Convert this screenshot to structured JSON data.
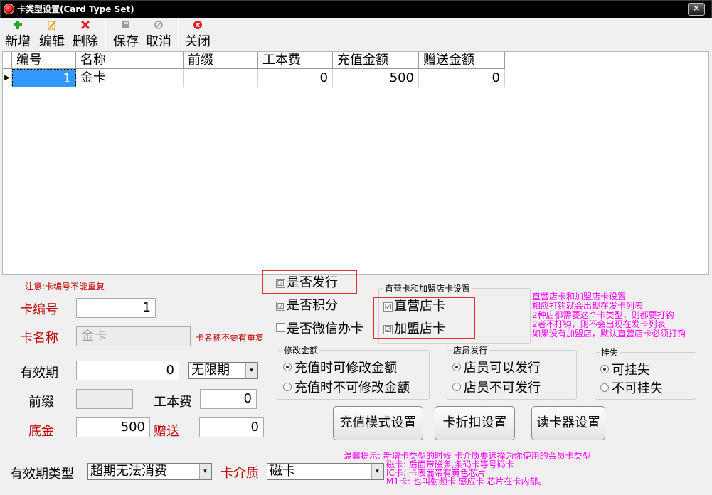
{
  "window": {
    "title": "卡类型设置(Card Type Set)",
    "close": "✕"
  },
  "toolbar": [
    {
      "key": "add",
      "label": "新增",
      "icon": "plus-icon"
    },
    {
      "key": "edit",
      "label": "编辑",
      "icon": "edit-icon"
    },
    {
      "key": "delete",
      "label": "删除",
      "icon": "delete-icon"
    },
    {
      "key": "save",
      "label": "保存",
      "icon": "save-icon"
    },
    {
      "key": "cancel",
      "label": "取消",
      "icon": "cancel-icon"
    },
    {
      "key": "close",
      "label": "关闭",
      "icon": "close-circle-icon"
    }
  ],
  "grid": {
    "columns": [
      "编号",
      "名称",
      "前缀",
      "工本费",
      "充值金额",
      "赠送金额"
    ],
    "rows": [
      [
        "1",
        "金卡",
        "",
        "0",
        "500",
        "0"
      ]
    ]
  },
  "form": {
    "notice": "注意:卡编号不能重复",
    "card_no_label": "卡编号",
    "card_no": "1",
    "card_name_label": "卡名称",
    "card_name": "金卡",
    "card_name_hint": "卡名称不要有重复",
    "validity_label": "有效期",
    "validity_value": "0",
    "validity_unit": "无限期",
    "prefix_label": "前缀",
    "prefix_value": "",
    "cost_label": "工本费",
    "cost_value": "0",
    "base_label": "底金",
    "base_value": "500",
    "gift_label": "赠送",
    "gift_value": "0",
    "validity_type_label": "有效期类型",
    "validity_type": "超期无法消费",
    "medium_label": "卡介质",
    "medium": "磁卡"
  },
  "checks": {
    "issue": {
      "label": "是否发行",
      "checked": true
    },
    "points": {
      "label": "是否积分",
      "checked": true
    },
    "wechat": {
      "label": "是否微信办卡",
      "checked": false
    }
  },
  "store_group": {
    "title": "直营卡和加盟店卡设置",
    "direct": {
      "label": "直营店卡",
      "checked": true
    },
    "franchise": {
      "label": "加盟店卡",
      "checked": true
    }
  },
  "store_note": [
    "直营店卡和加盟店卡设置",
    "相应打钩就会出现在发卡列表",
    "2种店都需要这个卡类型，则都要打钩",
    "2者不打钩，则不会出现在发卡列表",
    "如果没有加盟店，默认直营店卡必须打钩"
  ],
  "amount_group": {
    "title": "修改金额",
    "opt1": "充值时可修改金额",
    "opt2": "充值时不可修改金额"
  },
  "staff_group": {
    "title": "店员发行",
    "opt1": "店员可以发行",
    "opt2": "店员不可发行"
  },
  "loss_group": {
    "title": "挂失",
    "opt1": "可挂失",
    "opt2": "不可挂失"
  },
  "buttons": {
    "recharge": "充值模式设置",
    "discount": "卡折扣设置",
    "reader": "读卡器设置"
  },
  "tips": [
    "温馨提示: 新增卡类型的时候 卡介质要选择为你使用的会员卡类型",
    "磁卡: 后面带磁条,条码卡等号码卡",
    "IC卡: 卡表面带有黄色芯片",
    "M1卡: 也叫射频卡,感应卡 芯片在卡内部。"
  ],
  "icons": {
    "check": "☑",
    "dropdown": "▾"
  },
  "colors": {
    "accent_red": "#c00000",
    "hint_magenta": "#ff00ff",
    "selection": "#3399ff"
  }
}
